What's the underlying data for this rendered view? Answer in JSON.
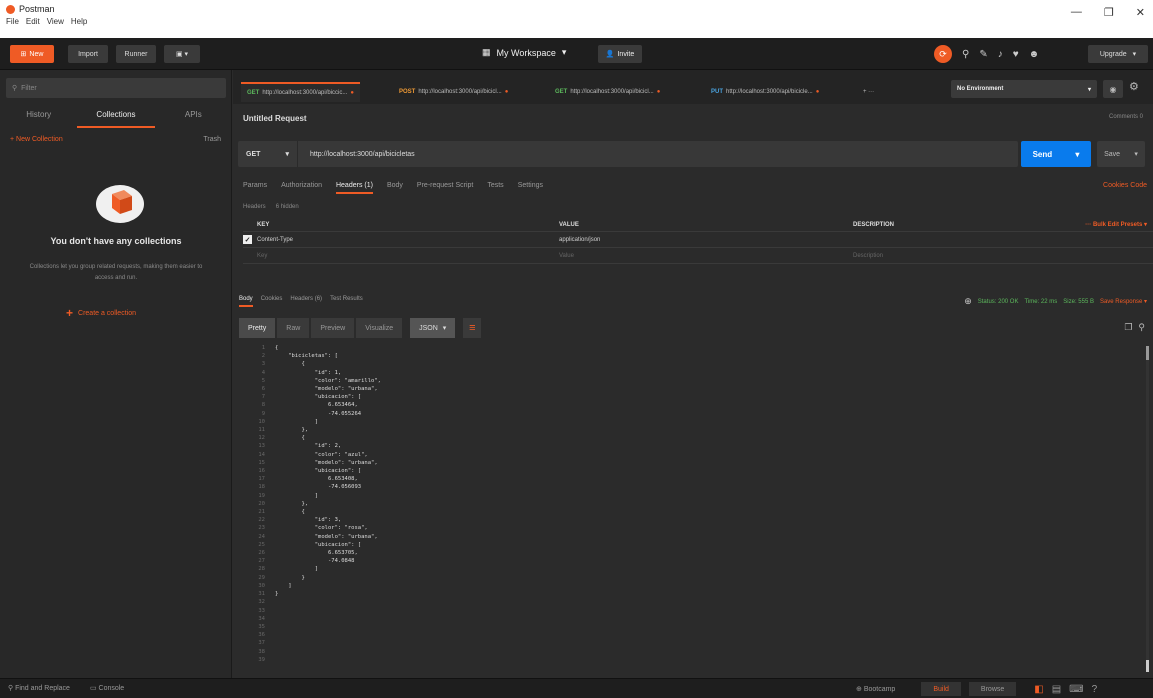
{
  "window": {
    "app_name": "Postman",
    "menu": [
      "File",
      "Edit",
      "View",
      "Help"
    ],
    "controls": [
      "—",
      "❐",
      "✕"
    ]
  },
  "header": {
    "new_label": "New",
    "import_label": "Import",
    "runner_label": "Runner",
    "workspace_label": "My Workspace",
    "invite_label": "Invite",
    "upgrade_label": "Upgrade"
  },
  "sidebar": {
    "search_placeholder": "Filter",
    "tabs": [
      "History",
      "Collections",
      "APIs"
    ],
    "new_collection": "+ New Collection",
    "trash": "Trash",
    "empty_title": "You don't have any collections",
    "empty_desc": "Collections let you group related requests, making them easier to access and run.",
    "create_label": "Create a collection"
  },
  "tabs": [
    {
      "method": "GET",
      "url": "http://localhost:3000/api/biccic..."
    },
    {
      "method": "POST",
      "url": "http://localhost:3000/api/bicicl..."
    },
    {
      "method": "GET",
      "url": "http://localhost:3000/api/bicicl..."
    },
    {
      "method": "PUT",
      "url": "http://localhost:3000/api/bicicle..."
    }
  ],
  "tabs_more": "+ ···",
  "environment": "No Environment",
  "request": {
    "name": "Untitled Request",
    "comments": "Comments 0",
    "method": "GET",
    "url": "http://localhost:3000/api/bicicletas",
    "send_label": "Send",
    "save_label": "Save",
    "tabs": [
      "Params",
      "Authorization",
      "Headers (1)",
      "Body",
      "Pre-request Script",
      "Tests",
      "Settings"
    ],
    "cookies": "Cookies  Code",
    "headers_sub": [
      "Headers",
      "6 hidden"
    ],
    "table_head": [
      "KEY",
      "VALUE",
      "DESCRIPTION"
    ],
    "table_row": {
      "key": "Content-Type",
      "value": "application/json",
      "checked": true
    },
    "placeholder_row": {
      "key": "Key",
      "value": "Value",
      "description": "Description"
    },
    "bulk": "···   Bulk Edit   Presets ▾"
  },
  "response": {
    "tabs": [
      "Body",
      "Cookies",
      "Headers (6)",
      "Test Results"
    ],
    "status": "Status: 200 OK",
    "time": "Time: 22 ms",
    "size": "Size: 555 B",
    "save_response": "Save Response ▾",
    "formats": [
      "Pretty",
      "Raw",
      "Preview",
      "Visualize"
    ],
    "format_select": "JSON",
    "lines": [
      "1",
      "2",
      "3",
      "4",
      "5",
      "6",
      "7",
      "8",
      "9",
      "10",
      "11",
      "12",
      "13",
      "14",
      "15",
      "16",
      "17",
      "18",
      "19",
      "20",
      "21",
      "22",
      "23",
      "24",
      "25",
      "26",
      "27",
      "28",
      "29",
      "30",
      "31",
      "32",
      "33",
      "34",
      "35",
      "36",
      "37",
      "38",
      "39"
    ],
    "code": [
      "{",
      "    \"bicicletas\": [",
      "        {",
      "            \"id\": 1,",
      "            \"color\": \"amarillo\",",
      "            \"modelo\": \"urbana\",",
      "            \"ubicacion\": [",
      "                6.653464,",
      "                -74.055264",
      "            ]",
      "        },",
      "        {",
      "            \"id\": 2,",
      "            \"color\": \"azul\",",
      "            \"modelo\": \"urbana\",",
      "            \"ubicacion\": [",
      "                6.653408,",
      "                -74.056093",
      "            ]",
      "        },",
      "        {",
      "            \"id\": 3,",
      "            \"color\": \"rosa\",",
      "            \"modelo\": \"urbana\",",
      "            \"ubicacion\": [",
      "                6.653705,",
      "                -74.0848",
      "            ]",
      "        }",
      "    ]",
      "}"
    ]
  },
  "footer": {
    "find": "Find and Replace",
    "console": "Console",
    "bootcamp": "Bootcamp",
    "build": "Build",
    "browse": "Browse"
  }
}
